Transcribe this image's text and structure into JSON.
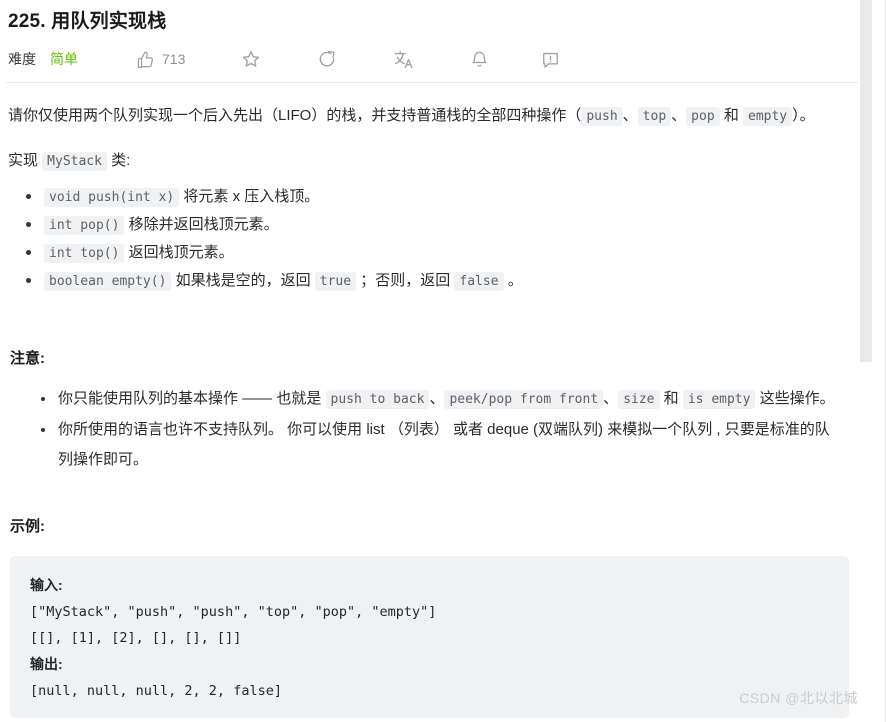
{
  "header": {
    "title": "225. 用队列实现栈",
    "difficulty_label": "难度",
    "difficulty_value": "简单",
    "like_count": "713",
    "difficulty_color": "#65c400",
    "icons": {
      "like": "thumbs-up-icon",
      "star": "star-icon",
      "share": "share-icon",
      "translate": "translate-icon",
      "bell": "bell-icon",
      "feedback": "feedback-icon"
    }
  },
  "description": {
    "p1_a": "请你仅使用两个队列实现一个后入先出（LIFO）的栈，并支持普通栈的全部四种操作（",
    "p1_code1": "push",
    "p1_b": "、",
    "p1_code2": "top",
    "p1_c": "、",
    "p1_code3": "pop",
    "p1_d": " 和 ",
    "p1_code4": "empty",
    "p1_e": "）。",
    "p2_a": "实现 ",
    "p2_code": "MyStack",
    "p2_b": " 类:"
  },
  "methods": [
    {
      "code": "void push(int x)",
      "text": " 将元素 x 压入栈顶。"
    },
    {
      "code": "int pop()",
      "text": " 移除并返回栈顶元素。"
    },
    {
      "code": "int top()",
      "text": " 返回栈顶元素。"
    },
    {
      "code": "boolean empty()",
      "text": " 如果栈是空的，返回 ",
      "code2": "true",
      "text2": " ；否则，返回 ",
      "code3": "false",
      "text3": " 。"
    }
  ],
  "notes": {
    "heading": "注意:",
    "item1_a": "你只能使用队列的基本操作 —— 也就是 ",
    "item1_code1": "push to back",
    "item1_b": "、",
    "item1_code2": "peek/pop from front",
    "item1_c": "、",
    "item1_code3": "size",
    "item1_d": " 和 ",
    "item1_code4": "is empty",
    "item1_e": " 这些操作。",
    "item2": "你所使用的语言也许不支持队列。 你可以使用 list （列表） 或者 deque (双端队列) 来模拟一个队列 , 只要是标准的队列操作即可。"
  },
  "example": {
    "heading": "示例:",
    "input_label": "输入:",
    "input_line1": "[\"MyStack\", \"push\", \"push\", \"top\", \"pop\", \"empty\"]",
    "input_line2": "[[], [1], [2], [], [], []]",
    "output_label": "输出:",
    "output_line1": "[null, null, null, 2, 2, false]"
  },
  "watermark": "CSDN @北以北城"
}
